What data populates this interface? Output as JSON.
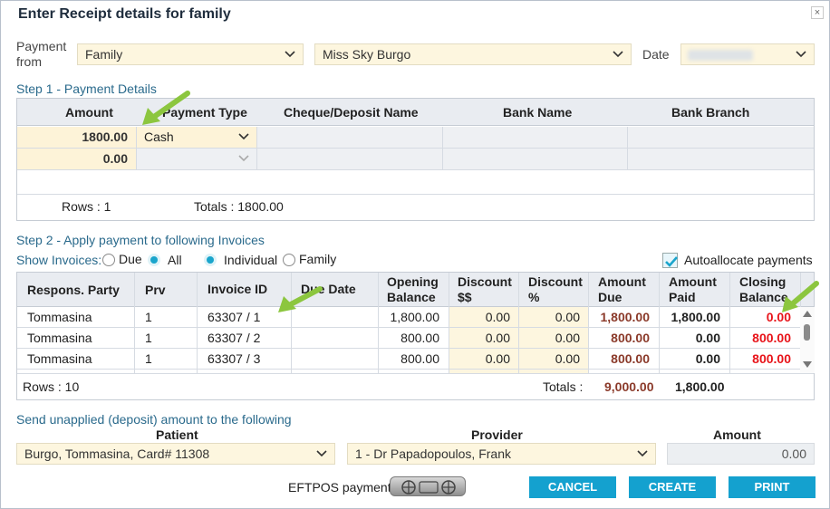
{
  "dialog": {
    "title": "Enter Receipt details for family",
    "close_glyph": "×"
  },
  "payment_from": {
    "label_line1": "Payment",
    "label_line2": "from",
    "type_value": "Family",
    "person_value": "Miss Sky  Burgo",
    "date_label": "Date",
    "date_value": ""
  },
  "step1": {
    "title": "Step 1 - Payment Details",
    "headers": [
      "Amount",
      "Payment Type",
      "Cheque/Deposit Name",
      "Bank Name",
      "Bank Branch"
    ],
    "rows": [
      {
        "amount": "1800.00",
        "type": "Cash"
      },
      {
        "amount": "0.00",
        "type": ""
      }
    ],
    "rows_label": "Rows : 1",
    "totals_label": "Totals : 1800.00"
  },
  "step2": {
    "title": "Step 2 - Apply payment to following Invoices",
    "show_label": "Show Invoices:",
    "opt_due": "Due",
    "opt_all": "All",
    "opt_individual": "Individual",
    "opt_family": "Family",
    "autoallocate": "Autoallocate payments",
    "headers": {
      "party": "Respons. Party",
      "prv": "Prv",
      "invoice": "Invoice ID",
      "due_date": "Due Date",
      "opening_1": "Opening",
      "opening_2": "Balance",
      "disc_dollar_1": "Discount",
      "disc_dollar_2": "$$",
      "disc_pct_1": "Discount",
      "disc_pct_2": "%",
      "amt_due_1": "Amount",
      "amt_due_2": "Due",
      "amt_paid_1": "Amount",
      "amt_paid_2": "Paid",
      "closing_1": "Closing",
      "closing_2": "Balance"
    },
    "rows": [
      {
        "party": "Tommasina",
        "prv": "1",
        "invoice": "63307 / 1",
        "due_date": "",
        "opening": "1,800.00",
        "disc_dollar": "0.00",
        "disc_pct": "0.00",
        "amt_due": "1,800.00",
        "amt_paid": "1,800.00",
        "closing": "0.00"
      },
      {
        "party": "Tommasina",
        "prv": "1",
        "invoice": "63307 / 2",
        "due_date": "",
        "opening": "800.00",
        "disc_dollar": "0.00",
        "disc_pct": "0.00",
        "amt_due": "800.00",
        "amt_paid": "0.00",
        "closing": "800.00"
      },
      {
        "party": "Tommasina",
        "prv": "1",
        "invoice": "63307 / 3",
        "due_date": "",
        "opening": "800.00",
        "disc_dollar": "0.00",
        "disc_pct": "0.00",
        "amt_due": "800.00",
        "amt_paid": "0.00",
        "closing": "800.00"
      }
    ],
    "rows_label": "Rows : 10",
    "totals_label": "Totals :",
    "totals_due": "9,000.00",
    "totals_paid": "1,800.00"
  },
  "deposit": {
    "title": "Send unapplied (deposit) amount to the following",
    "patient_label": "Patient",
    "patient_value": "Burgo, Tommasina, Card# 11308",
    "provider_label": "Provider",
    "provider_value": "1 - Dr Papadopoulos, Frank",
    "amount_label": "Amount",
    "amount_value": "0.00"
  },
  "footer": {
    "eftpos_label": "EFTPOS payment",
    "cancel": "CANCEL",
    "create": "CREATE",
    "print": "PRINT"
  },
  "colors": {
    "accent": "#14a1cf",
    "step_title": "#2a6a8c",
    "amount_due": "#8b3a2a",
    "closing_red": "#e8141a",
    "annotation_arrow": "#8cc63f"
  },
  "icons": [
    "close-icon",
    "chevron-down-icon",
    "checkmark-icon",
    "eftpos-icon",
    "annotation-arrow-icon"
  ]
}
